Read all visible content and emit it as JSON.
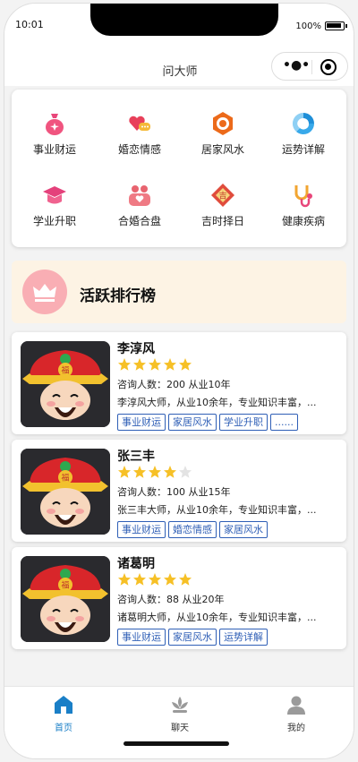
{
  "status": {
    "time": "10:01",
    "battery": "100%"
  },
  "nav": {
    "title": "问大师"
  },
  "categories": [
    {
      "label": "事业财运",
      "icon": "money-bag-icon"
    },
    {
      "label": "婚恋情感",
      "icon": "hearts-chat-icon"
    },
    {
      "label": "居家风水",
      "icon": "hexagon-house-icon"
    },
    {
      "label": "运势详解",
      "icon": "fortune-circle-icon"
    },
    {
      "label": "学业升职",
      "icon": "graduation-cap-icon"
    },
    {
      "label": "合婚合盘",
      "icon": "couple-icon"
    },
    {
      "label": "吉时择日",
      "icon": "auspicious-diamond-icon"
    },
    {
      "label": "健康疾病",
      "icon": "stethoscope-icon"
    }
  ],
  "ranking": {
    "title": "活跃排行榜",
    "icon": "crown-icon"
  },
  "masters": [
    {
      "name": "李淳风",
      "rating": 5,
      "stats": "咨询人数：200  从业10年",
      "desc": "李淳风大师，从业10余年，专业知识丰富，...",
      "tags": [
        "事业财运",
        "家居风水",
        "学业升职",
        "......"
      ]
    },
    {
      "name": "张三丰",
      "rating": 4,
      "stats": "咨询人数：100  从业15年",
      "desc": "张三丰大师，从业10余年，专业知识丰富，...",
      "tags": [
        "事业财运",
        "婚恋情感",
        "家居风水"
      ]
    },
    {
      "name": "诸葛明",
      "rating": 5,
      "stats": "咨询人数：88  从业20年",
      "desc": "诸葛明大师，从业10余年，专业知识丰富，...",
      "tags": [
        "事业财运",
        "家居风水",
        "运势详解"
      ]
    }
  ],
  "tabs": [
    {
      "label": "首页",
      "icon": "home-icon",
      "active": true
    },
    {
      "label": "聊天",
      "icon": "chat-lotus-icon",
      "active": false
    },
    {
      "label": "我的",
      "icon": "user-icon",
      "active": false
    }
  ],
  "colors": {
    "accent": "#1a7fc7",
    "star": "#f6c026",
    "star_empty": "#e3e3e3",
    "tag": "#2f5fb6",
    "banner": "#fdf3e4"
  }
}
